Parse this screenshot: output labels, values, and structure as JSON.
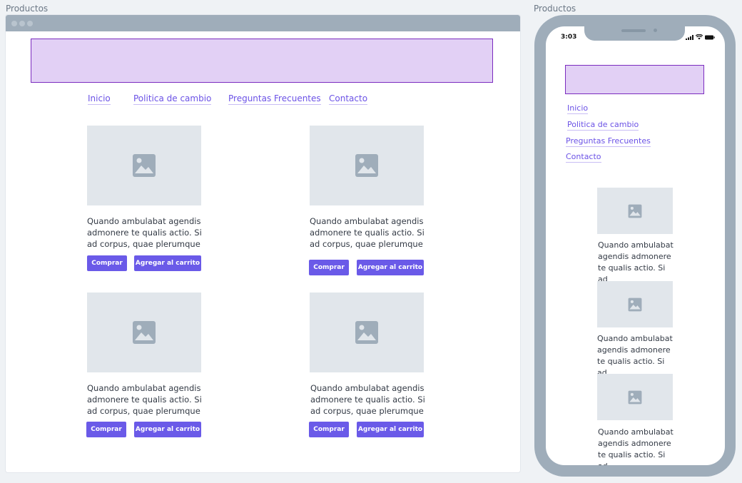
{
  "desktop": {
    "label": "Productos",
    "nav": [
      "Inicio",
      "Politica de cambio",
      "Preguntas Frecuentes",
      "Contacto"
    ],
    "cards": [
      {
        "text": "Quando ambulabat agendis admonere te qualis actio. Si ad corpus, quae plerumque",
        "buy": "Comprar",
        "cart": "Agregar al carrito"
      },
      {
        "text": "Quando ambulabat agendis admonere te qualis actio. Si ad corpus, quae plerumque",
        "buy": "Comprar",
        "cart": "Agregar al carrito"
      },
      {
        "text": "Quando ambulabat agendis admonere te qualis actio. Si ad corpus, quae plerumque",
        "buy": "Comprar",
        "cart": "Agregar al carrito"
      },
      {
        "text": "Quando ambulabat agendis admonere te qualis actio. Si ad corpus, quae plerumque",
        "buy": "Comprar",
        "cart": "Agregar al carrito"
      }
    ]
  },
  "mobile": {
    "label": "Productos",
    "time": "3:03",
    "nav": [
      "Inicio",
      "Politica de cambio",
      "Preguntas Frecuentes",
      "Contacto"
    ],
    "cards": [
      {
        "text": "Quando ambulabat agendis admonere te qualis actio. Si ad"
      },
      {
        "text": "Quando ambulabat agendis admonere te qualis actio. Si ad"
      },
      {
        "text": "Quando ambulabat agendis admonere te qualis actio. Si ad"
      }
    ],
    "status_icons": [
      "signal-icon",
      "wifi-icon",
      "battery-icon"
    ]
  },
  "icons": {
    "placeholder": "image-placeholder-icon"
  },
  "colors": {
    "accent": "#6a5ae8",
    "link": "#6b52e6",
    "header_fill": "#e2d0f5",
    "header_border": "#7b2cbf",
    "frame": "#9fadba",
    "placeholder": "#e1e6eb"
  }
}
